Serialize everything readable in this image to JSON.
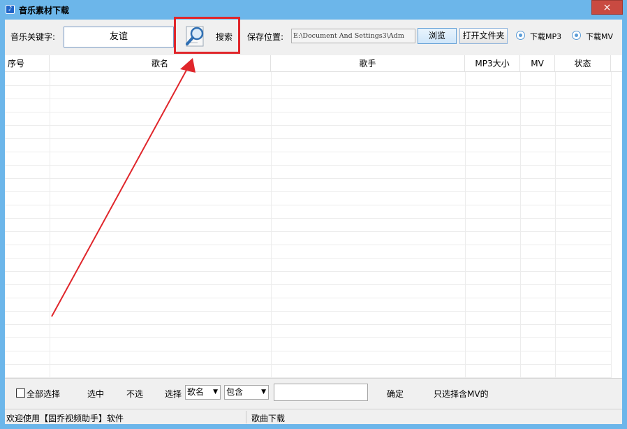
{
  "window": {
    "title": "音乐素材下载",
    "close_label": "×"
  },
  "toolbar": {
    "keyword_label": "音乐关键字:",
    "keyword_value": "友谊",
    "search_label": "搜索",
    "save_label": "保存位置:",
    "save_path": "E:\\Document And Settings3\\Adm",
    "browse_label": "浏览",
    "open_folder_label": "打开文件夹",
    "download_mp3_label": "下载MP3",
    "download_mv_label": "下载MV"
  },
  "table": {
    "columns": [
      "序号",
      "歌名",
      "歌手",
      "MP3大小",
      "MV",
      "状态"
    ],
    "rows": []
  },
  "bottom": {
    "select_all_label": "全部选择",
    "select_label": "选中",
    "unselect_label": "不选",
    "choose_label": "选择",
    "field_select_value": "歌名",
    "match_select_value": "包含",
    "filter_value": "",
    "confirm_label": "确定",
    "mv_only_label": "只选择含MV的"
  },
  "status": {
    "left_text": "欢迎使用【固乔视频助手】软件",
    "right_text": "歌曲下载"
  },
  "colors": {
    "highlight": "#e0262b",
    "title_bar": "#6cb6ea",
    "close": "#c94a41"
  }
}
